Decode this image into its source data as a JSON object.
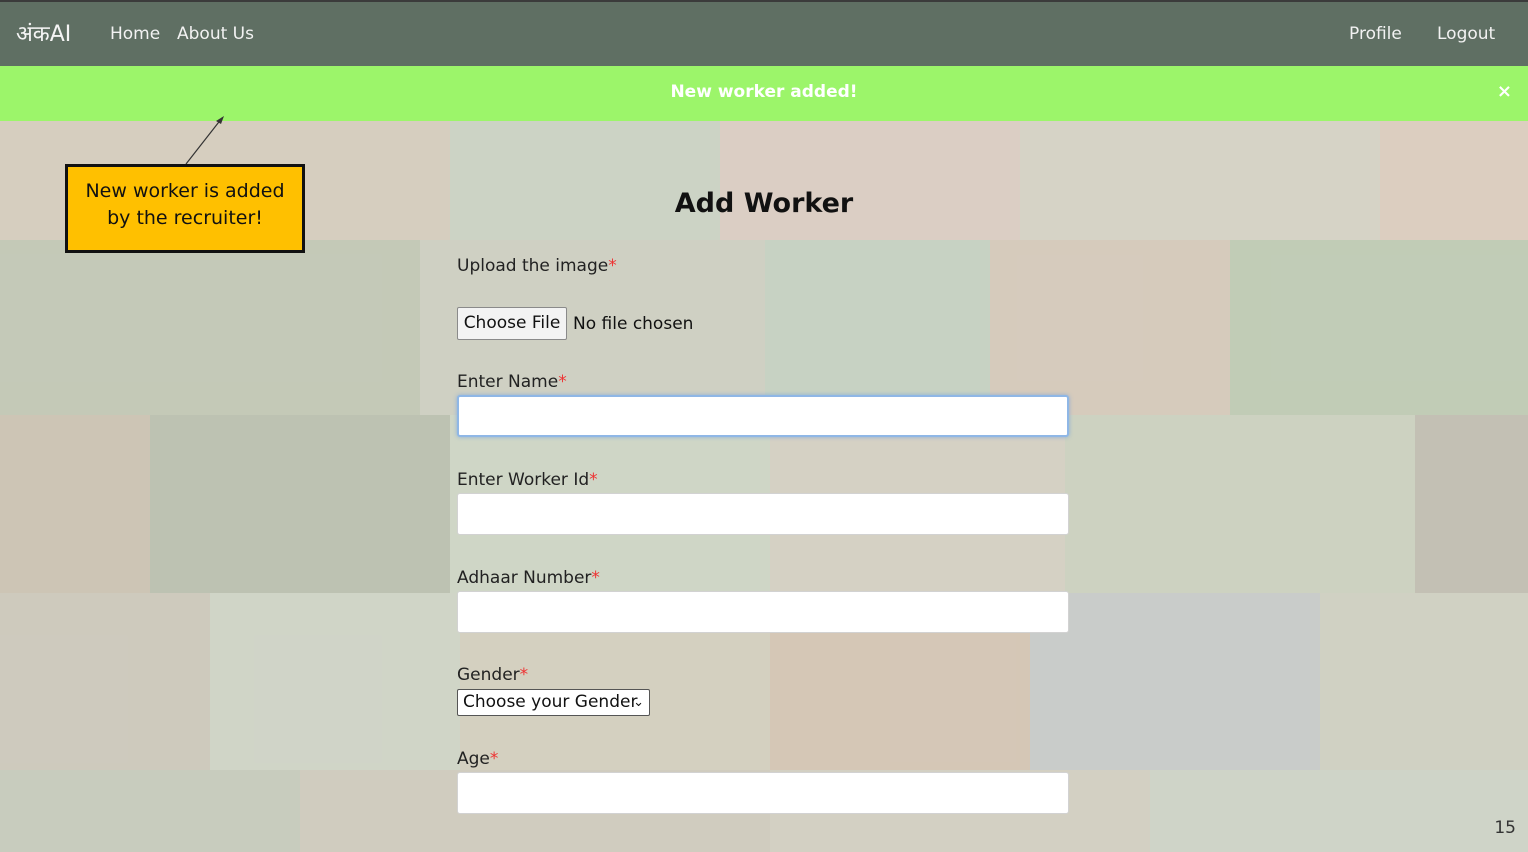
{
  "navbar": {
    "brand": "अंकAI",
    "links": [
      "Home",
      "About Us"
    ],
    "right_links": [
      "Profile",
      "Logout"
    ]
  },
  "alert": {
    "message": "New worker added!",
    "close": "×"
  },
  "callout": {
    "line1": "New worker is added",
    "line2": "by the recruiter!"
  },
  "form": {
    "title": "Add Worker",
    "required_mark": "*",
    "upload_label": "Upload the image",
    "file_button": "Choose File",
    "file_status": "No file chosen",
    "name_label": "Enter Name",
    "worker_id_label": "Enter Worker Id",
    "adhaar_label": "Adhaar Number",
    "gender_label": "Gender",
    "gender_selected": "Choose your Gender",
    "age_label": "Age"
  },
  "slide_number": "15",
  "colors": {
    "navbar": "#5f6f63",
    "alert": "#9cf56a",
    "callout": "#ffc000",
    "required": "#ee3333"
  }
}
